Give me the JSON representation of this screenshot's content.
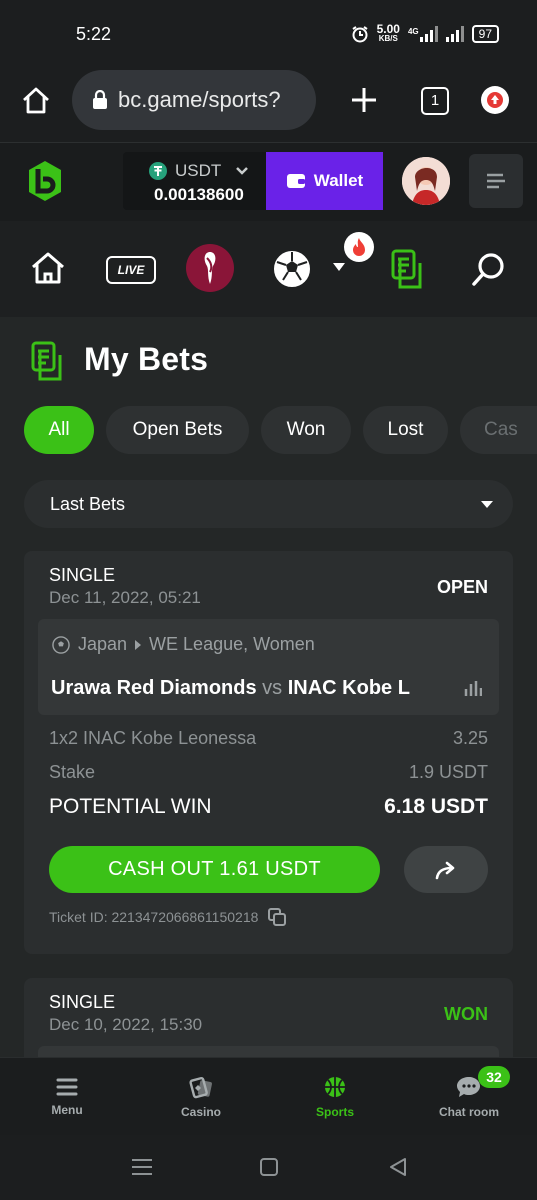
{
  "status_bar": {
    "time": "5:22",
    "net_speed": "5.00",
    "net_unit": "KB/S",
    "network": "4G",
    "battery": "97"
  },
  "browser": {
    "url": "bc.game/sports?",
    "tab_count": "1"
  },
  "header": {
    "currency": "USDT",
    "balance": "0.00138600",
    "wallet_label": "Wallet"
  },
  "sport_nav": {
    "live_label": "LIVE"
  },
  "page": {
    "title": "My Bets"
  },
  "filters": {
    "chips": [
      {
        "label": "All",
        "active": true
      },
      {
        "label": "Open Bets",
        "active": false
      },
      {
        "label": "Won",
        "active": false
      },
      {
        "label": "Lost",
        "active": false
      },
      {
        "label": "Cas",
        "active": false
      }
    ],
    "dropdown_value": "Last Bets"
  },
  "bets": [
    {
      "type": "SINGLE",
      "date": "Dec 11, 2022, 05:21",
      "status": "OPEN",
      "country": "Japan",
      "league": "WE League, Women",
      "home": "Urawa Red Diamonds",
      "vs": "vs",
      "away": "INAC Kobe L",
      "selection": "1x2 INAC Kobe Leonessa",
      "odds": "3.25",
      "stake_label": "Stake",
      "stake": "1.9 USDT",
      "potential_label": "POTENTIAL WIN",
      "potential": "6.18 USDT",
      "cashout_label": "CASH OUT 1.61 USDT",
      "ticket": "Ticket ID: 2213472066861150218"
    },
    {
      "type": "SINGLE",
      "date": "Dec 10, 2022, 15:30",
      "status": "WON"
    }
  ],
  "bottom_nav": {
    "items": [
      {
        "label": "Menu",
        "icon": "hamburger-icon"
      },
      {
        "label": "Casino",
        "icon": "casino-icon"
      },
      {
        "label": "Sports",
        "icon": "basketball-icon",
        "active": true
      },
      {
        "label": "Chat room",
        "icon": "chat-icon"
      }
    ],
    "chat_badge": "32"
  },
  "colors": {
    "accent_green": "#3bc117",
    "wallet_purple": "#6a22e8",
    "background": "#232626"
  }
}
